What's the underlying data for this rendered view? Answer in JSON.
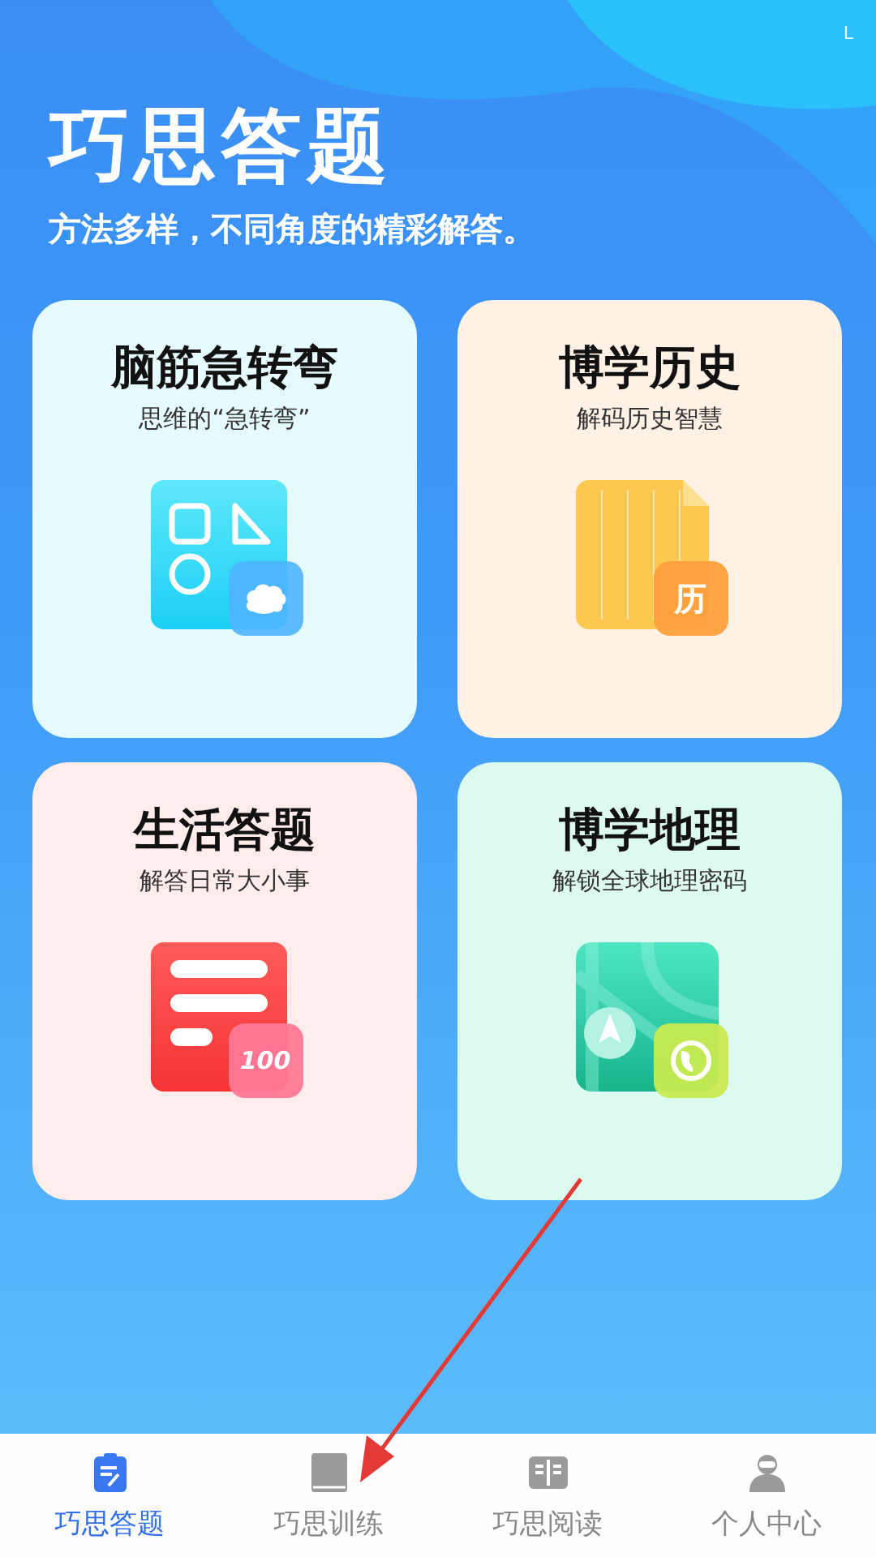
{
  "status_bar": {
    "indicator": "L"
  },
  "header": {
    "title": "巧思答题",
    "subtitle": "方法多样，不同角度的精彩解答。"
  },
  "cards": [
    {
      "kind": "shapes",
      "title": "脑筋急转弯",
      "subtitle": "思维的“急转弯”"
    },
    {
      "kind": "history",
      "title": "博学历史",
      "subtitle": "解码历史智慧",
      "badge": "历"
    },
    {
      "kind": "list",
      "title": "生活答题",
      "subtitle": "解答日常大小事",
      "badge": "100"
    },
    {
      "kind": "map",
      "title": "博学地理",
      "subtitle": "解锁全球地理密码"
    }
  ],
  "tab_bar": [
    {
      "kind": "quiz",
      "label": "巧思答题",
      "selected": true
    },
    {
      "kind": "book",
      "label": "巧思训练",
      "selected": false
    },
    {
      "kind": "reading",
      "label": "巧思阅读",
      "selected": false
    },
    {
      "kind": "person",
      "label": "个人中心",
      "selected": false
    }
  ]
}
